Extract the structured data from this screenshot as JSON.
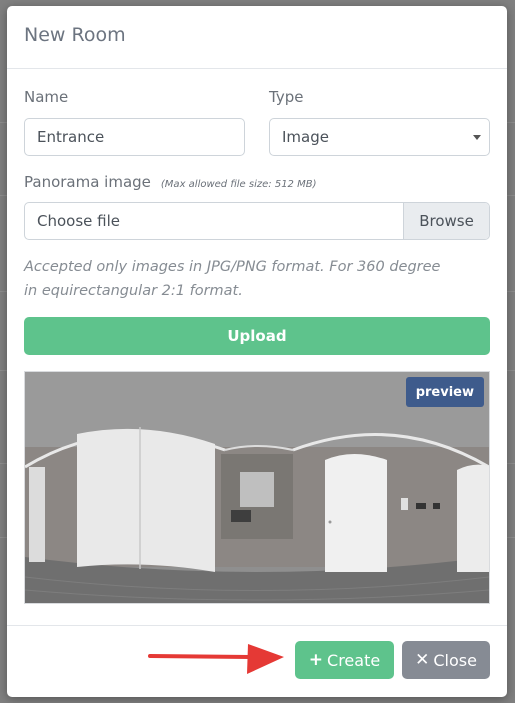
{
  "modal": {
    "title": "New Room",
    "name_label": "Name",
    "name_value": "Entrance",
    "type_label": "Type",
    "type_value": "Image",
    "panorama_label": "Panorama image",
    "panorama_hint": "(Max allowed file size: 512 MB)",
    "file_placeholder": "Choose file",
    "browse_label": "Browse",
    "accepted_note": "Accepted only images in JPG/PNG format. For 360 degree in equirectangular 2:1 format.",
    "upload_label": "Upload",
    "preview_badge": "preview"
  },
  "footer": {
    "create_icon": "plus-icon",
    "create_label": "Create",
    "close_icon": "x-icon",
    "close_label": "Close"
  },
  "colors": {
    "green": "#5ec38c",
    "gray_button": "#868b94",
    "badge_blue": "#3e5b8c",
    "arrow_red": "#e53935"
  }
}
